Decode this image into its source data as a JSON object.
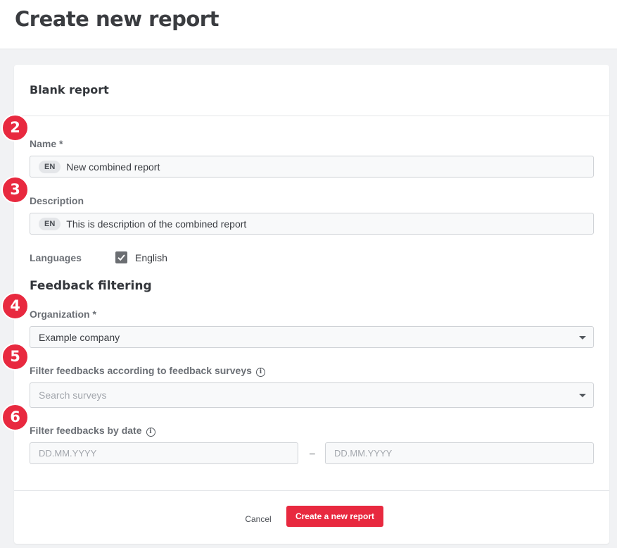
{
  "page": {
    "title": "Create new report"
  },
  "card": {
    "title": "Blank report"
  },
  "form": {
    "name": {
      "label": "Name *",
      "lang": "EN",
      "value": "New combined report"
    },
    "description": {
      "label": "Description",
      "lang": "EN",
      "value": "This is description of the combined report"
    },
    "languages": {
      "label": "Languages",
      "option": "English",
      "checked": true
    },
    "feedback_filtering": {
      "title": "Feedback filtering"
    },
    "organization": {
      "label": "Organization *",
      "value": "Example company"
    },
    "surveys": {
      "label": "Filter feedbacks according to feedback surveys",
      "placeholder": "Search surveys"
    },
    "date": {
      "label": "Filter feedbacks by date",
      "from_placeholder": "DD.MM.YYYY",
      "separator": "–",
      "to_placeholder": "DD.MM.YYYY"
    }
  },
  "actions": {
    "cancel": "Cancel",
    "create": "Create a new report"
  },
  "annotations": [
    "2",
    "3",
    "4",
    "5",
    "6"
  ],
  "colors": {
    "accent": "#e8293f",
    "checkbox": "#6b6e72"
  }
}
